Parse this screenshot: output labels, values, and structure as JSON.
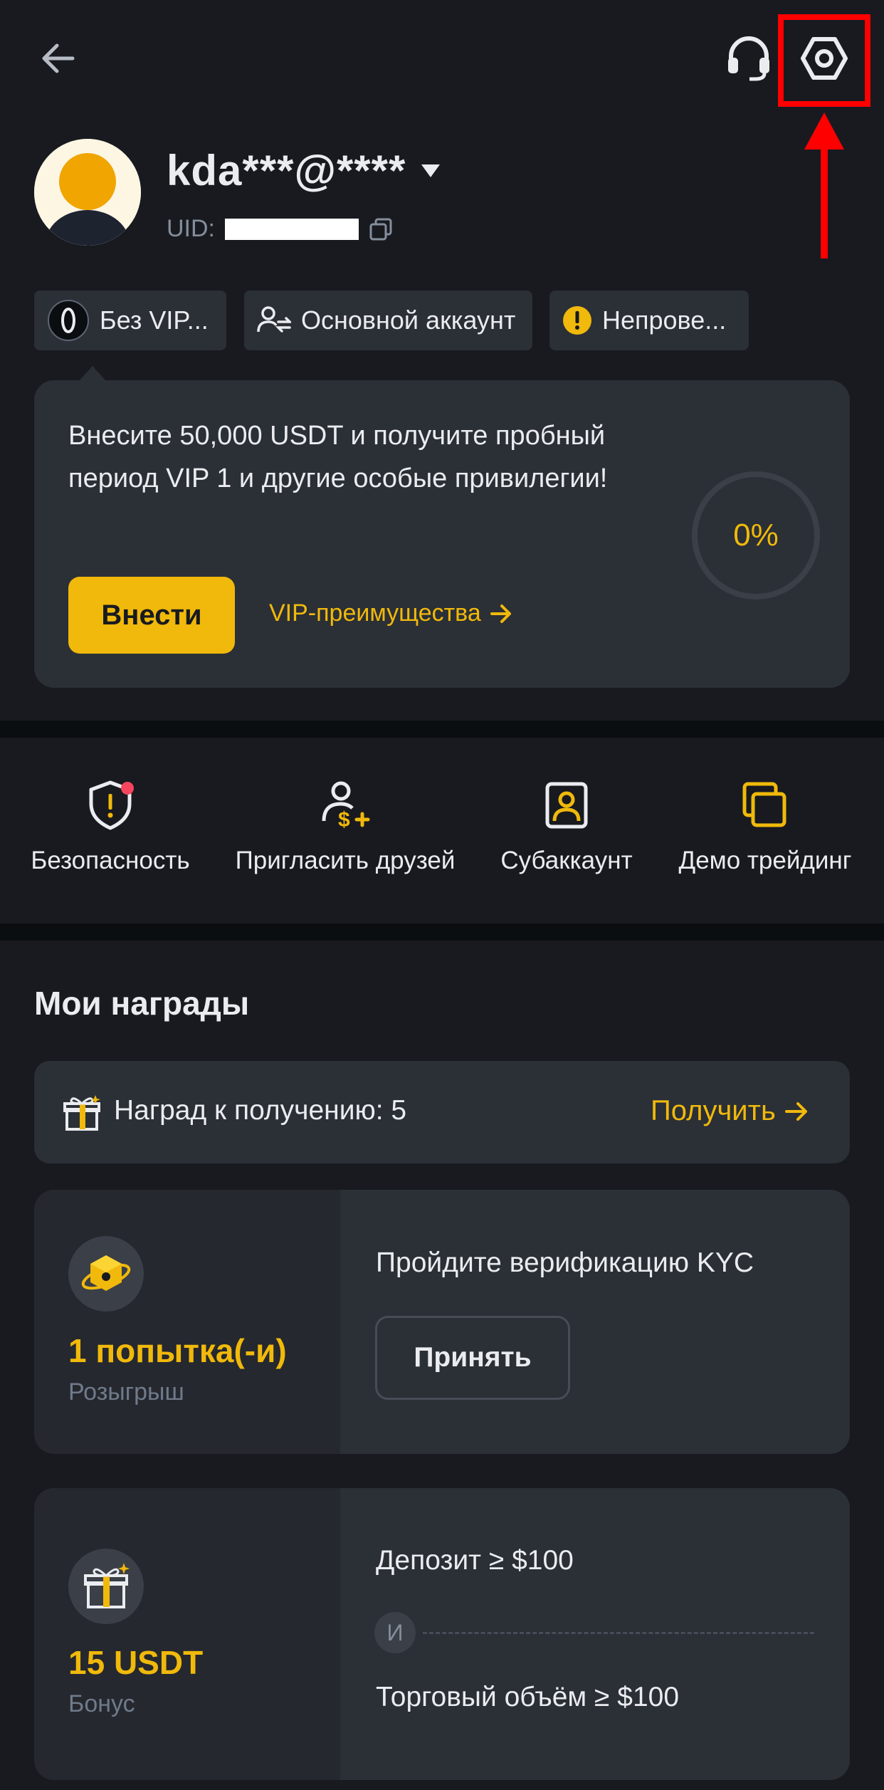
{
  "header": {
    "back_icon": "back-arrow-icon",
    "support_icon": "headset-icon",
    "settings_icon": "settings-hexagon-icon"
  },
  "profile": {
    "username": "kda***@****",
    "uid_label": "UID:",
    "copy_icon": "copy-icon"
  },
  "chips": [
    {
      "label": "Без VIP...",
      "icon": "vip-badge-icon"
    },
    {
      "label": "Основной аккаунт",
      "icon": "account-switch-icon"
    },
    {
      "label": "Непрове...",
      "icon": "warning-circle-icon"
    }
  ],
  "vip_card": {
    "text": "Внесите 50,000 USDT и получите пробный период VIP 1 и другие особые привилегии!",
    "deposit_button": "Внести",
    "benefits_link": "VIP-преимущества",
    "progress_label": "0%",
    "progress": 0
  },
  "quick_actions": [
    {
      "label": "Безопасность",
      "icon": "shield-alert-icon"
    },
    {
      "label": "Пригласить друзей",
      "icon": "invite-user-icon"
    },
    {
      "label": "Субаккаунт",
      "icon": "subaccount-icon"
    },
    {
      "label": "Демо трейдинг",
      "icon": "demo-trading-icon"
    }
  ],
  "rewards": {
    "title": "Мои награды",
    "claim_bar": {
      "label": "Наград к получению: 5",
      "action": "Получить"
    },
    "cards": [
      {
        "amount": "1 попытка(-и)",
        "subtitle": "Розыгрыш",
        "task": "Пройдите верификацию KYC",
        "button": "Принять"
      },
      {
        "amount": "15 USDT",
        "subtitle": "Бонус",
        "condition_1": "Депозит ≥ $100",
        "connector": "И",
        "condition_2": "Торговый объём ≥ $100"
      }
    ]
  },
  "colors": {
    "background": "#181a20",
    "card": "#2b2f36",
    "accent": "#f0b90b",
    "annotation": "#ff0000"
  }
}
